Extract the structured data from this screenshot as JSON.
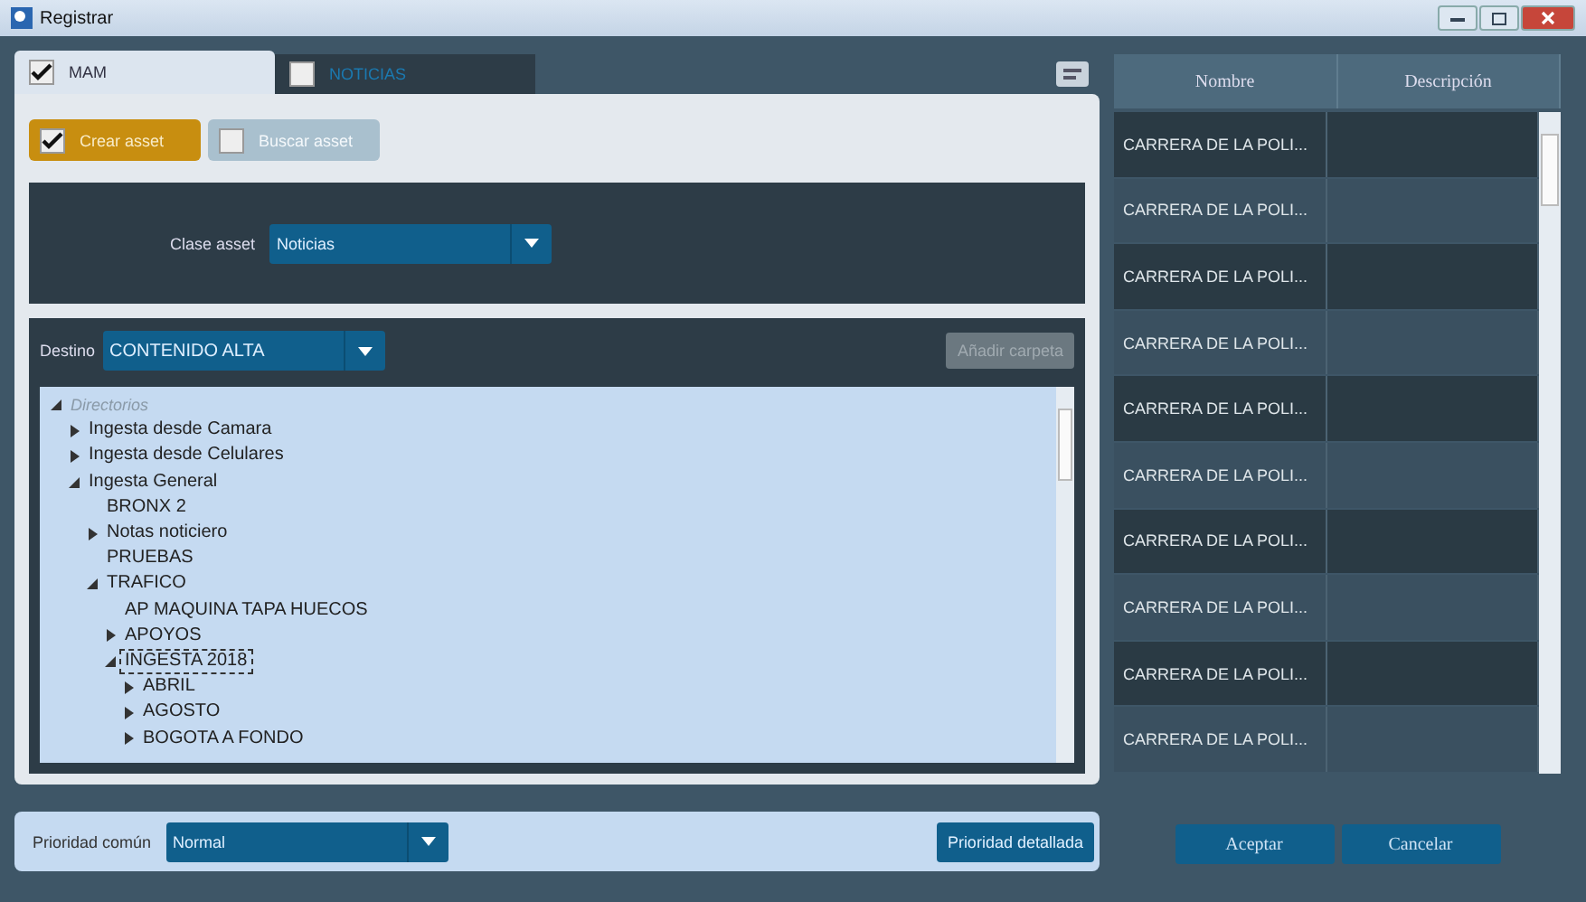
{
  "window": {
    "title": "Registrar"
  },
  "tabs": [
    {
      "label": "MAM",
      "selected": true,
      "checked": true
    },
    {
      "label": "NOTICIAS",
      "selected": false,
      "checked": false
    }
  ],
  "mode_buttons": [
    {
      "label": "Crear asset",
      "selected": true
    },
    {
      "label": "Buscar asset",
      "selected": false
    }
  ],
  "asset_class": {
    "label": "Clase asset",
    "value": "Noticias"
  },
  "destination": {
    "label": "Destino",
    "value": "CONTENIDO ALTA",
    "add_folder_button": {
      "label": "Añadir carpeta",
      "disabled": true
    }
  },
  "tree": [
    {
      "label": "Directorios",
      "kind": "root",
      "expanded": true,
      "selected": false,
      "children": [
        {
          "label": "Ingesta desde Camara",
          "expanded": false,
          "selected": false
        },
        {
          "label": "Ingesta desde Celulares",
          "expanded": false,
          "selected": false
        },
        {
          "label": "Ingesta General",
          "expanded": true,
          "selected": false,
          "children": [
            {
              "label": "BRONX 2",
              "selected": false
            },
            {
              "label": "Notas noticiero",
              "expanded": false,
              "selected": false
            },
            {
              "label": "PRUEBAS",
              "selected": false
            },
            {
              "label": "TRAFICO",
              "expanded": true,
              "selected": false,
              "children": [
                {
                  "label": "AP MAQUINA TAPA HUECOS",
                  "selected": false
                },
                {
                  "label": "APOYOS",
                  "expanded": false,
                  "selected": false
                },
                {
                  "label": "INGESTA 2018",
                  "expanded": true,
                  "selected": true,
                  "children": [
                    {
                      "label": "ABRIL",
                      "expanded": false,
                      "selected": false
                    },
                    {
                      "label": "AGOSTO",
                      "expanded": false,
                      "selected": false
                    },
                    {
                      "label": "BOGOTA A FONDO",
                      "expanded": false,
                      "selected": false
                    }
                  ]
                }
              ]
            }
          ]
        }
      ]
    }
  ],
  "priority": {
    "label": "Prioridad común",
    "value": "Normal",
    "detail_button": "Prioridad detallada"
  },
  "table": {
    "columns": [
      "Nombre",
      "Descripción"
    ],
    "rows": [
      [
        "CARRERA DE LA POLI...",
        ""
      ],
      [
        "CARRERA DE LA POLI...",
        ""
      ],
      [
        "CARRERA DE LA POLI...",
        ""
      ],
      [
        "CARRERA DE LA POLI...",
        ""
      ],
      [
        "CARRERA DE LA POLI...",
        ""
      ],
      [
        "CARRERA DE LA POLI...",
        ""
      ],
      [
        "CARRERA DE LA POLI...",
        ""
      ],
      [
        "CARRERA DE LA POLI...",
        ""
      ],
      [
        "CARRERA DE LA POLI...",
        ""
      ],
      [
        "CARRERA DE LA POLI...",
        ""
      ]
    ]
  },
  "buttons": [
    "Aceptar",
    "Cancelar"
  ]
}
